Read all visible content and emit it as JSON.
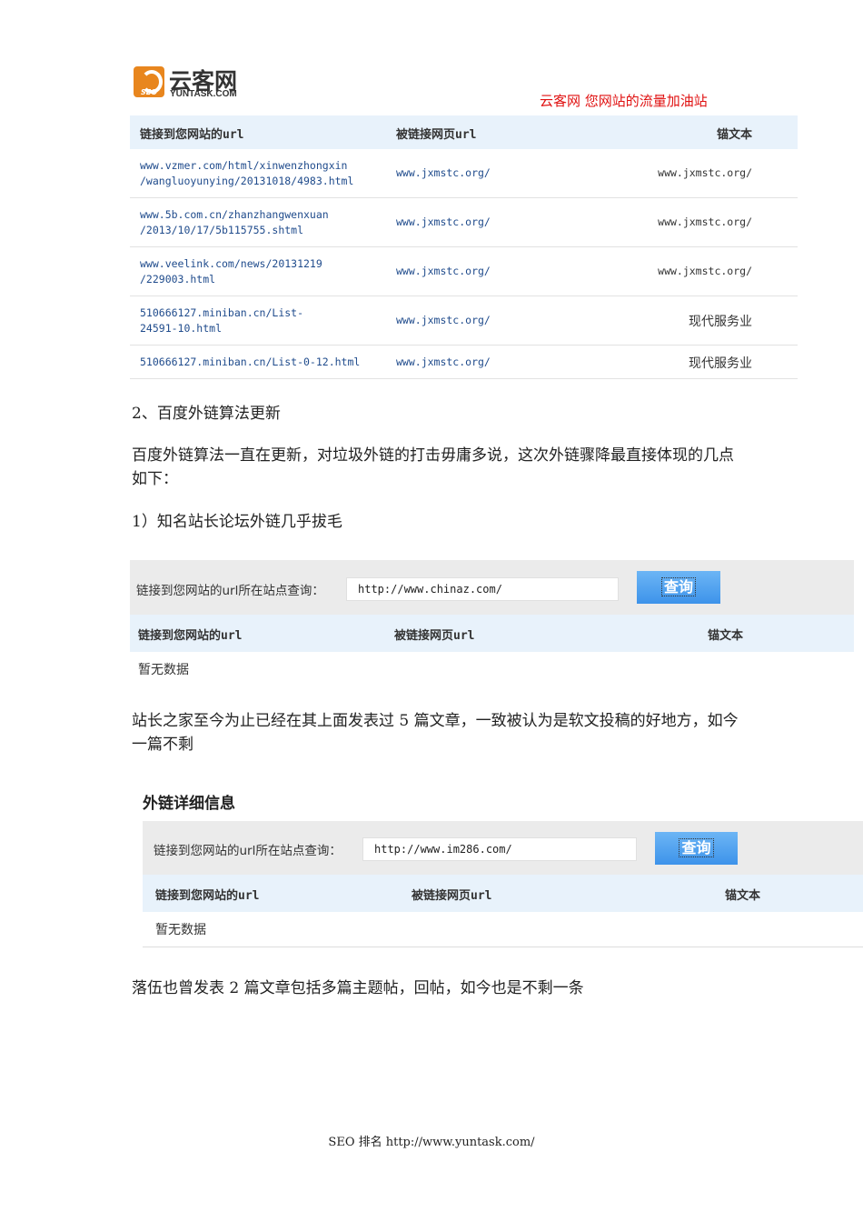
{
  "header": {
    "logo_cn": "云客网",
    "logo_en": "YUNTASK.COM",
    "logo_badge": "SEO",
    "slogan": "云客网  您网站的流量加油站"
  },
  "table1": {
    "headers": [
      "链接到您网站的url",
      "被链接网页url",
      "锚文本"
    ],
    "rows": [
      {
        "source": [
          "www.vzmer.com/html/xinwenzhongxin",
          "/wangluoyunying/20131018/4983.html"
        ],
        "target": "www.jxmstc.org/",
        "anchor": "www.jxmstc.org/"
      },
      {
        "source": [
          "www.5b.com.cn/zhanzhangwenxuan",
          "/2013/10/17/5b115755.shtml"
        ],
        "target": "www.jxmstc.org/",
        "anchor": "www.jxmstc.org/"
      },
      {
        "source": [
          "www.veelink.com/news/20131219",
          "/229003.html"
        ],
        "target": "www.jxmstc.org/",
        "anchor": "www.jxmstc.org/"
      },
      {
        "source": [
          "510666127.miniban.cn/List-",
          "24591-10.html"
        ],
        "target": "www.jxmstc.org/",
        "anchor": "现代服务业"
      },
      {
        "source": [
          "510666127.miniban.cn/List-0-12.html",
          ""
        ],
        "target": "www.jxmstc.org/",
        "anchor": "现代服务业"
      }
    ]
  },
  "section_title": "2、百度外链算法更新",
  "para1": "百度外链算法一直在更新，对垃圾外链的打击毋庸多说，这次外链骤降最直接体现的几点如下：",
  "point1": "1）知名站长论坛外链几乎拔毛",
  "shot1": {
    "query_label": "链接到您网站的url所在站点查询：",
    "query_value": "http://www.chinaz.com/",
    "query_button": "查询",
    "headers": [
      "链接到您网站的url",
      "被链接网页url",
      "锚文本"
    ],
    "empty": "暂无数据"
  },
  "para2": "站长之家至今为止已经在其上面发表过 5 篇文章，一致被认为是软文投稿的好地方，如今一篇不剩",
  "shot2": {
    "title": "外链详细信息",
    "query_label": "链接到您网站的url所在站点查询：",
    "query_value": "http://www.im286.com/",
    "query_button": "查询",
    "headers": [
      "链接到您网站的url",
      "被链接网页url",
      "锚文本"
    ],
    "empty": "暂无数据"
  },
  "para3": "落伍也曾发表 2 篇文章包括多篇主题帖，回帖，如今也是不剩一条",
  "footer": "SEO 排名 http://www.yuntask.com/"
}
